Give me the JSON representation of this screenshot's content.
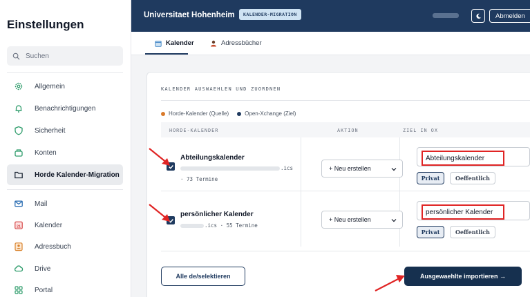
{
  "sidebar": {
    "title": "Einstellungen",
    "search_placeholder": "Suchen",
    "items": [
      {
        "label": "Allgemein"
      },
      {
        "label": "Benachrichtigungen"
      },
      {
        "label": "Sicherheit"
      },
      {
        "label": "Konten"
      },
      {
        "label": "Horde Kalender-Migration"
      },
      {
        "label": "Mail"
      },
      {
        "label": "Kalender"
      },
      {
        "label": "Adressbuch"
      },
      {
        "label": "Drive"
      },
      {
        "label": "Portal"
      }
    ]
  },
  "header": {
    "brand": "Universitaet Hohenheim",
    "badge": "KALENDER-MIGRATION",
    "logout_label": "Abmelden"
  },
  "tabs": [
    {
      "label": "Kalender"
    },
    {
      "label": "Adressbücher"
    }
  ],
  "card": {
    "title": "KALENDER AUSWAEHLEN UND ZUORDNEN",
    "legend_source": "Horde-Kalender (Quelle)",
    "legend_target": "Open-Xchange (Ziel)",
    "columns": {
      "horde": "HORDE-KALENDER",
      "action": "AKTION",
      "target": "ZIEL IN OX"
    },
    "rows": [
      {
        "name": "Abteilungskalender",
        "ext": ".ics",
        "count": "· 73 Termine",
        "action": "+ Neu erstellen",
        "target": "Abteilungskalender",
        "privat": "Privat",
        "oeff": "Oeffentlich"
      },
      {
        "name": "persönlicher Kalender",
        "ext": ".ics · 55 Termine",
        "action": "+ Neu erstellen",
        "target": "persönlicher Kalender",
        "privat": "Privat",
        "oeff": "Oeffentlich"
      }
    ],
    "select_all_label": "Alle de/selektieren",
    "import_label": "Ausgewaehlte importieren →"
  },
  "colors": {
    "primary": "#1f3a5f",
    "source_dot": "#d97a2b",
    "target_dot": "#1f3a5f",
    "highlight": "#e02424"
  }
}
